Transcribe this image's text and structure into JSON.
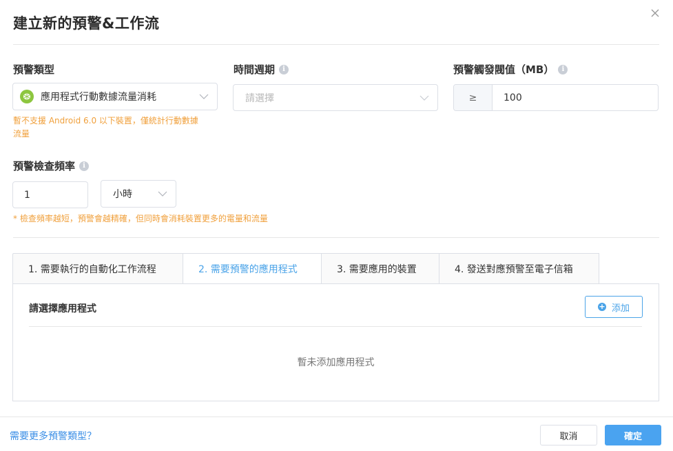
{
  "dialog": {
    "title": "建立新的預警&工作流"
  },
  "form": {
    "alert_type": {
      "label": "預警類型",
      "value": "應用程式行動數據流量消耗",
      "icon": "android-icon",
      "hint_line1": "暫不支援 Android 6.0 以下裝置，僅統計行動數據",
      "hint_line2": "流量"
    },
    "time_period": {
      "label": "時間週期",
      "placeholder": "請選擇"
    },
    "threshold": {
      "label": "預警觸發閥值（MB）",
      "operator": "≥",
      "value": "100"
    },
    "check_frequency": {
      "label": "預警檢查頻率",
      "value": "1",
      "unit": "小時",
      "hint": "* 檢查頻率越短，預警會越精確，但同時會消耗裝置更多的電量和流量"
    }
  },
  "tabs": [
    {
      "label": "1. 需要執行的自動化工作流程",
      "active": false
    },
    {
      "label": "2. 需要預警的應用程式",
      "active": true
    },
    {
      "label": "3. 需要應用的裝置",
      "active": false
    },
    {
      "label": "4. 發送對應預警至電子信箱",
      "active": false
    }
  ],
  "panel": {
    "title": "請選擇應用程式",
    "add_label": "添加",
    "empty_text": "暫未添加應用程式"
  },
  "footer": {
    "more_link": "需要更多預警類型？",
    "cancel_label": "取消",
    "confirm_label": "確定"
  },
  "colors": {
    "accent": "#4aa3e8",
    "warning": "#f0a03c",
    "android": "#8dc63f"
  }
}
